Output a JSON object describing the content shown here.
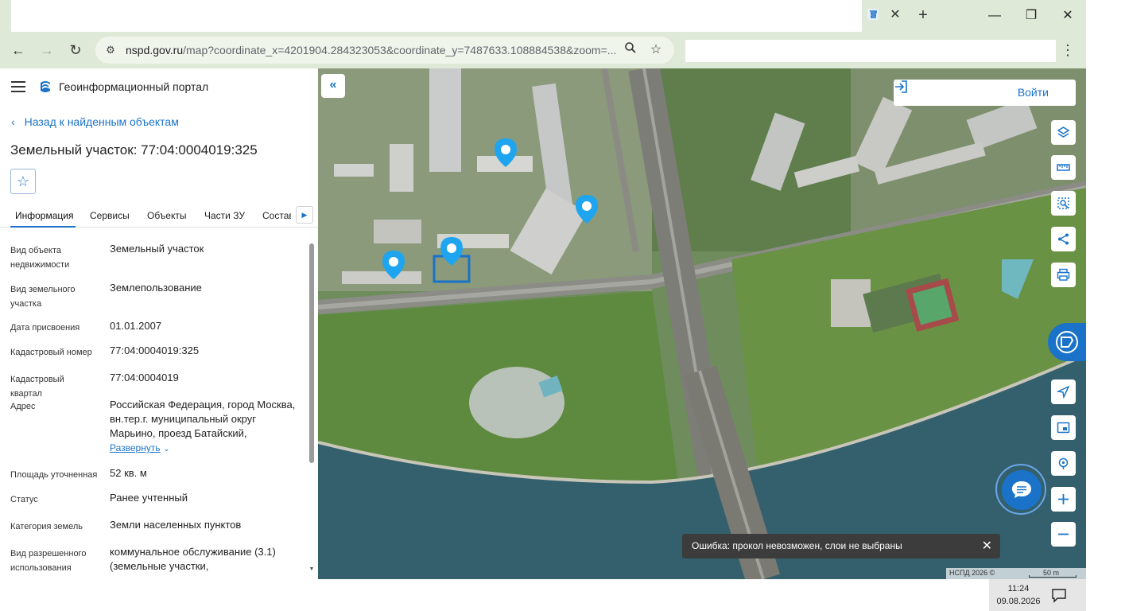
{
  "browser": {
    "url_host": "nspd.gov.ru",
    "url_path": "/map?coordinate_x=4201904.284323053&coordinate_y=7487633.108884538&zoom=..."
  },
  "panel": {
    "portal_title": "Геоинформационный портал",
    "back_link": "Назад к найденным объектам",
    "object_title": "Земельный участок: 77:04:0004019:325",
    "tabs": [
      "Информация",
      "Сервисы",
      "Объекты",
      "Части ЗУ",
      "Состав"
    ],
    "active_tab": "Информация",
    "properties": [
      {
        "label": "Вид объекта недвижимости",
        "value": "Земельный участок"
      },
      {
        "label": "Вид земельного участка",
        "value": "Землепользование"
      },
      {
        "label": "Дата присвоения",
        "value": "01.01.2007"
      },
      {
        "label": "Кадастровый номер",
        "value": "77:04:0004019:325"
      },
      {
        "label": "Кадастровый квартал",
        "value": "77:04:0004019"
      },
      {
        "label": "Адрес",
        "value": "Российская Федерация, город Москва, вн.тер.г. муниципальный округ Марьино, проезд Батайский,",
        "expand": "Развернуть"
      },
      {
        "label": "Площадь уточненная",
        "value": "52 кв. м"
      },
      {
        "label": "Статус",
        "value": "Ранее учтенный"
      },
      {
        "label": "Категория земель",
        "value": "Земли населенных пунктов"
      },
      {
        "label": "Вид разрешенного использования",
        "value": "коммунальное обслуживание (3.1) (земельные участки,"
      }
    ]
  },
  "map": {
    "login_label": "Войти",
    "error_toast": "Ошибка: прокол невозможен, слои не выбраны",
    "attribution": "НСПД 2026 ©",
    "scale_label": "50 m",
    "colors": {
      "accent": "#1a73c8",
      "water": "#2f5a6a",
      "parcel": "#1a73c8"
    },
    "tool_icons": [
      "layers-icon",
      "ruler-icon",
      "select-area-icon",
      "share-icon",
      "print-icon",
      "pkk-icon",
      "locate-icon",
      "minimap-icon",
      "geolocation-icon",
      "zoom-in-icon",
      "zoom-out-icon"
    ]
  },
  "taskbar": {
    "time": "11:24",
    "date": "09.08.2026"
  }
}
